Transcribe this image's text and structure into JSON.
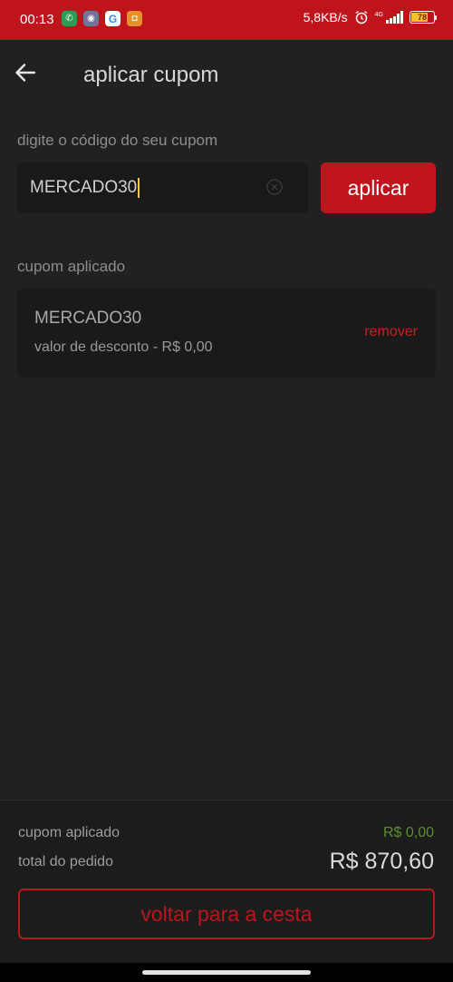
{
  "status_bar": {
    "time": "00:13",
    "net_speed": "5,8KB/s",
    "network_type": "4G",
    "battery_level": "78",
    "notification_icons": [
      "whatsapp-icon",
      "app-icon",
      "google-icon",
      "store-icon"
    ],
    "colors": {
      "background": "#c0141d",
      "battery_fill": "#f2c230"
    }
  },
  "header": {
    "title": "aplicar cupom",
    "back_icon": "arrow-left-icon"
  },
  "coupon_form": {
    "label": "digite o código do seu cupom",
    "input_value": "MERCADO30",
    "apply_label": "aplicar"
  },
  "applied_coupon": {
    "section_label": "cupom aplicado",
    "code": "MERCADO30",
    "discount_text": "valor de desconto - R$ 0,00",
    "remove_label": "remover"
  },
  "summary": {
    "coupon_label": "cupom aplicado",
    "coupon_value": "R$ 0,00",
    "total_label": "total do pedido",
    "total_value": "R$ 870,60",
    "back_button_label": "voltar para a cesta"
  },
  "colors": {
    "accent": "#c0141d",
    "background": "#212121",
    "discount_green": "#5d8f2f"
  }
}
